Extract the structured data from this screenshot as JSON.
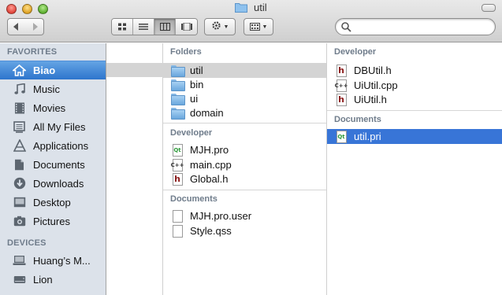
{
  "window": {
    "title": "util"
  },
  "toolbar": {
    "back_icon": "chevron-left-icon",
    "forward_icon": "chevron-right-icon",
    "view_modes": [
      "icon-view",
      "list-view",
      "column-view",
      "cover-flow-view"
    ],
    "active_view": "column-view",
    "action_icon": "gear-icon",
    "arrange_icon": "arrange-grid-icon"
  },
  "search": {
    "value": "",
    "placeholder": ""
  },
  "sidebar": {
    "favorites_header": "FAVORITES",
    "favorites": [
      {
        "label": "Biao",
        "icon": "home-icon",
        "selected": true
      },
      {
        "label": "Music",
        "icon": "music-icon"
      },
      {
        "label": "Movies",
        "icon": "movies-icon"
      },
      {
        "label": "All My Files",
        "icon": "all-files-icon"
      },
      {
        "label": "Applications",
        "icon": "applications-icon"
      },
      {
        "label": "Documents",
        "icon": "documents-icon"
      },
      {
        "label": "Downloads",
        "icon": "downloads-icon"
      },
      {
        "label": "Desktop",
        "icon": "desktop-icon"
      },
      {
        "label": "Pictures",
        "icon": "pictures-icon"
      }
    ],
    "devices_header": "DEVICES",
    "devices": [
      {
        "label": "Huang’s M...",
        "icon": "computer-icon"
      },
      {
        "label": "Lion",
        "icon": "disk-icon"
      }
    ]
  },
  "column2": {
    "groups": [
      {
        "header": "Folders",
        "items": [
          {
            "name": "util",
            "type": "folder",
            "selected_dim": true
          },
          {
            "name": "bin",
            "type": "folder"
          },
          {
            "name": "ui",
            "type": "folder"
          },
          {
            "name": "domain",
            "type": "folder"
          }
        ]
      },
      {
        "header": "Developer",
        "items": [
          {
            "name": "MJH.pro",
            "type": "pro"
          },
          {
            "name": "main.cpp",
            "type": "cpp"
          },
          {
            "name": "Global.h",
            "type": "h"
          }
        ]
      },
      {
        "header": "Documents",
        "items": [
          {
            "name": "MJH.pro.user",
            "type": "doc"
          },
          {
            "name": "Style.qss",
            "type": "doc"
          }
        ]
      }
    ]
  },
  "column3": {
    "groups": [
      {
        "header": "Developer",
        "items": [
          {
            "name": "DBUtil.h",
            "type": "h"
          },
          {
            "name": "UiUtil.cpp",
            "type": "cpp"
          },
          {
            "name": "UiUtil.h",
            "type": "h"
          }
        ]
      },
      {
        "header": "Documents",
        "items": [
          {
            "name": "util.pri",
            "type": "pro",
            "selected": true
          }
        ]
      }
    ]
  },
  "colors": {
    "selection_blue": "#3875d7",
    "sidebar_bg": "#dce2ea",
    "header_gray": "#6f7c8b"
  }
}
